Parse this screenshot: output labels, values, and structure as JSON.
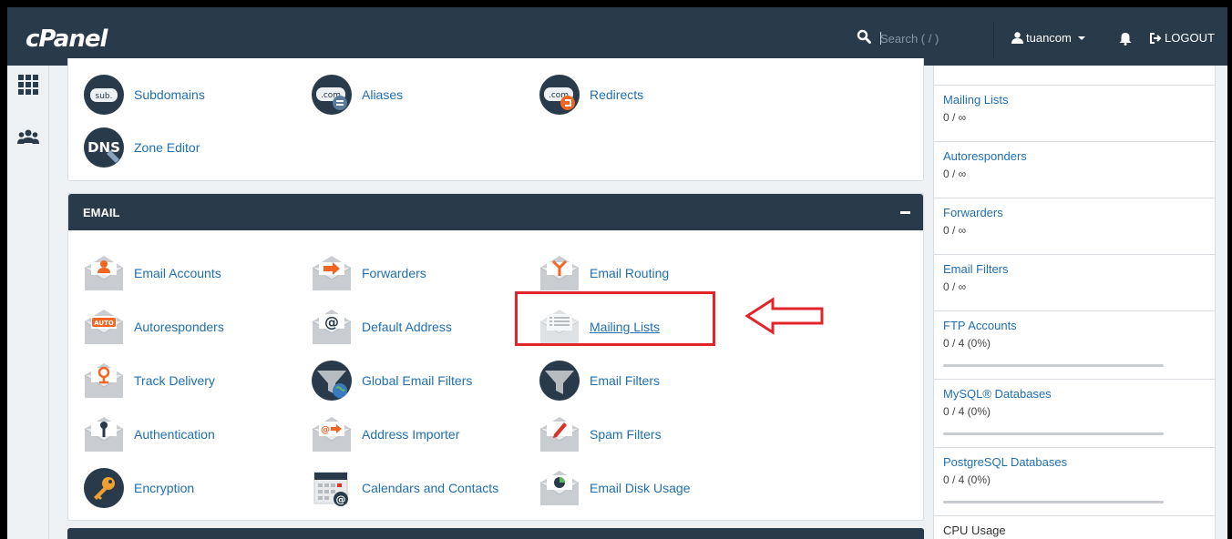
{
  "header": {
    "logo": "cPanel",
    "search_placeholder": "Search ( / )",
    "user": "tuancom",
    "logout_label": "LOGOUT"
  },
  "domains_items": [
    {
      "label": "Subdomains",
      "icon": "subdomains-icon"
    },
    {
      "label": "Aliases",
      "icon": "aliases-icon"
    },
    {
      "label": "Redirects",
      "icon": "redirects-icon"
    },
    {
      "label": "Zone Editor",
      "icon": "zone-editor-icon"
    }
  ],
  "email": {
    "title": "EMAIL",
    "items": [
      {
        "label": "Email Accounts"
      },
      {
        "label": "Forwarders"
      },
      {
        "label": "Email Routing"
      },
      {
        "label": "Autoresponders"
      },
      {
        "label": "Default Address"
      },
      {
        "label": "Mailing Lists"
      },
      {
        "label": "Track Delivery"
      },
      {
        "label": "Global Email Filters"
      },
      {
        "label": "Email Filters"
      },
      {
        "label": "Authentication"
      },
      {
        "label": "Address Importer"
      },
      {
        "label": "Spam Filters"
      },
      {
        "label": "Encryption"
      },
      {
        "label": "Calendars and Contacts"
      },
      {
        "label": "Email Disk Usage"
      }
    ]
  },
  "stats": [
    {
      "name": "Mailing Lists",
      "value": "0 / ∞"
    },
    {
      "name": "Autoresponders",
      "value": "0 / ∞"
    },
    {
      "name": "Forwarders",
      "value": "0 / ∞"
    },
    {
      "name": "Email Filters",
      "value": "0 / ∞"
    },
    {
      "name": "FTP Accounts",
      "value": "0 / 4  (0%)",
      "fraction": 0
    },
    {
      "name": "MySQL® Databases",
      "value": "0 / 4  (0%)",
      "fraction": 0
    },
    {
      "name": "PostgreSQL Databases",
      "value": "0 / 4  (0%)",
      "fraction": 0
    },
    {
      "name": "CPU Usage"
    }
  ],
  "colors": {
    "header": "#293a4a",
    "link": "#1f6fb2",
    "annotation": "#e2242b"
  }
}
